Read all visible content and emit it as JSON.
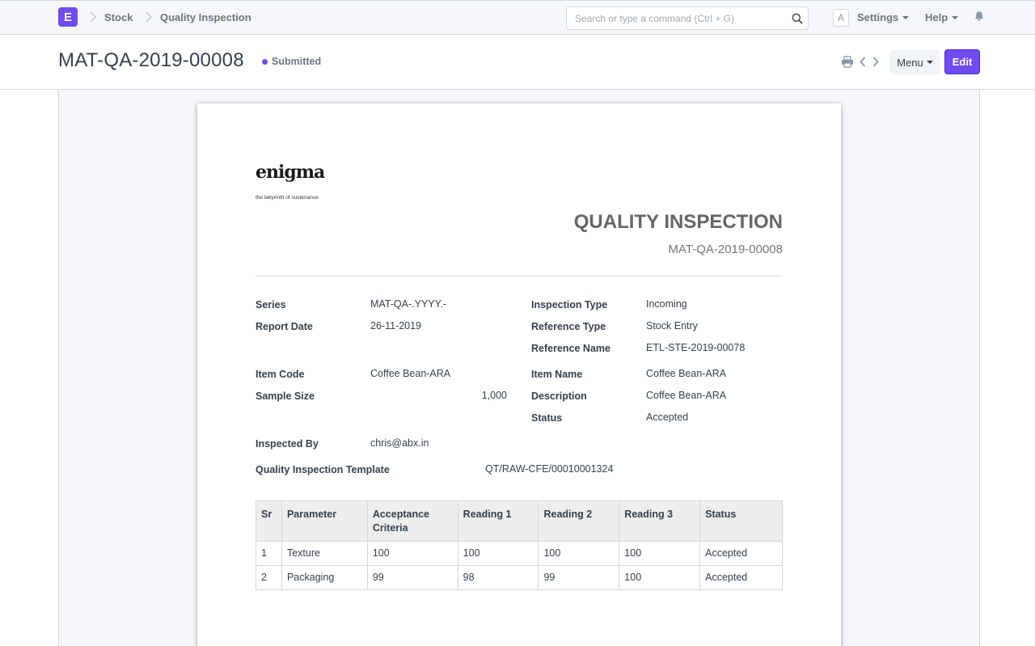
{
  "navbar": {
    "logo_letter": "E",
    "breadcrumbs": [
      "Stock",
      "Quality Inspection"
    ],
    "search_placeholder": "Search or type a command (Ctrl + G)",
    "avatar_letter": "A",
    "settings_label": "Settings",
    "help_label": "Help"
  },
  "page_head": {
    "title": "MAT-QA-2019-00008",
    "status": "Submitted",
    "status_color": "#6e4cf5",
    "menu_label": "Menu",
    "edit_label": "Edit",
    "accent_color": "#6e4cf5"
  },
  "document": {
    "brand_name": "enigma",
    "brand_tagline": "the labyrinth of sustenance",
    "heading": "QUALITY INSPECTION",
    "name": "MAT-QA-2019-00008",
    "fields": {
      "series": {
        "label": "Series",
        "value": "MAT-QA-.YYYY.-"
      },
      "report_date": {
        "label": "Report Date",
        "value": "26-11-2019"
      },
      "inspection_type": {
        "label": "Inspection Type",
        "value": "Incoming"
      },
      "reference_type": {
        "label": "Reference Type",
        "value": "Stock Entry"
      },
      "reference_name": {
        "label": "Reference Name",
        "value": "ETL-STE-2019-00078"
      },
      "item_code": {
        "label": "Item Code",
        "value": "Coffee Bean-ARA"
      },
      "sample_size": {
        "label": "Sample Size",
        "value": "1,000"
      },
      "item_name": {
        "label": "Item Name",
        "value": "Coffee Bean-ARA"
      },
      "description": {
        "label": "Description",
        "value": "Coffee Bean-ARA"
      },
      "status": {
        "label": "Status",
        "value": "Accepted"
      },
      "inspected_by": {
        "label": "Inspected By",
        "value": "chris@abx.in"
      },
      "template": {
        "label": "Quality Inspection Template",
        "value": "QT/RAW-CFE/00010001324"
      }
    },
    "readings_table": {
      "headers": [
        "Sr",
        "Parameter",
        "Acceptance Criteria",
        "Reading 1",
        "Reading 2",
        "Reading 3",
        "Status"
      ],
      "rows": [
        [
          "1",
          "Texture",
          "100",
          "100",
          "100",
          "100",
          "Accepted"
        ],
        [
          "2",
          "Packaging",
          "99",
          "98",
          "99",
          "100",
          "Accepted"
        ]
      ]
    }
  }
}
